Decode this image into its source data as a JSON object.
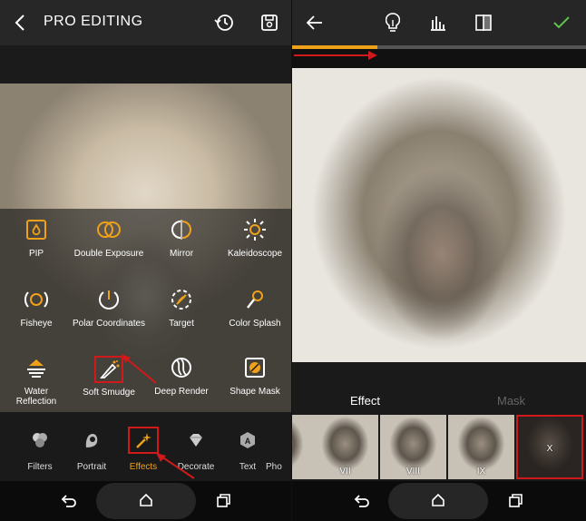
{
  "left": {
    "header": {
      "title": "PRO EDITING",
      "icons": [
        "back-icon",
        "history-icon",
        "save-icon"
      ]
    },
    "tools": [
      {
        "label": "PIP",
        "icon": "pip-icon"
      },
      {
        "label": "Double Exposure",
        "icon": "double-exposure-icon"
      },
      {
        "label": "Mirror",
        "icon": "mirror-icon"
      },
      {
        "label": "Kaleidoscope",
        "icon": "kaleidoscope-icon"
      },
      {
        "label": "Fisheye",
        "icon": "fisheye-icon"
      },
      {
        "label": "Polar Coordinates",
        "icon": "polar-coordinates-icon"
      },
      {
        "label": "Target",
        "icon": "target-icon"
      },
      {
        "label": "Color Splash",
        "icon": "color-splash-icon"
      },
      {
        "label": "Water\nReflection",
        "icon": "water-reflection-icon"
      },
      {
        "label": "Soft Smudge",
        "icon": "soft-smudge-icon",
        "highlighted": true
      },
      {
        "label": "Deep Render",
        "icon": "deep-render-icon"
      },
      {
        "label": "Shape Mask",
        "icon": "shape-mask-icon"
      }
    ],
    "tabs": [
      {
        "label": "Filters",
        "icon": "filters-icon"
      },
      {
        "label": "Portrait",
        "icon": "portrait-icon"
      },
      {
        "label": "Effects",
        "icon": "effects-icon",
        "active": true
      },
      {
        "label": "Decorate",
        "icon": "decorate-icon"
      },
      {
        "label": "Text",
        "icon": "text-icon"
      },
      {
        "label": "Pho",
        "icon": "photo-icon"
      }
    ]
  },
  "right": {
    "header": {
      "icons": [
        "back-arrow-icon",
        "light-bulb-icon",
        "histogram-icon",
        "compare-icon",
        "check-icon"
      ]
    },
    "progress": 0.29,
    "segments": {
      "effect": "Effect",
      "mask": "Mask"
    },
    "thumbnails": [
      {
        "label": ""
      },
      {
        "label": "VII"
      },
      {
        "label": "VIII"
      },
      {
        "label": "IX"
      },
      {
        "label": "X",
        "selected": true
      }
    ]
  },
  "colors": {
    "accent": "#f0a11a",
    "highlight_red": "#d0191b",
    "confirm_green": "#5fc24c"
  },
  "navbar": {
    "icons": [
      "back-nav-icon",
      "home-icon",
      "recents-icon"
    ]
  }
}
